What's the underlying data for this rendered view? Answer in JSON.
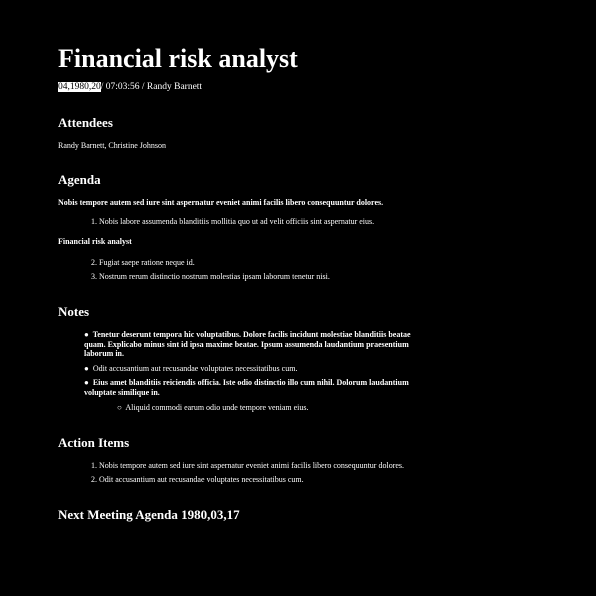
{
  "title": "Financial risk analyst",
  "meta": {
    "date": "04,1980,20",
    "rest": "/ 07:03:56 / Randy Barnett"
  },
  "attendees": {
    "heading": "Attendees",
    "names": "Randy Barnett, Christine Johnson"
  },
  "agenda": {
    "heading": "Agenda",
    "intro": "Nobis tempore autem sed iure sint aspernatur eveniet animi facilis libero consequuntur dolores.",
    "items_a": [
      "1. Nobis labore assumenda blanditiis mollitia quo ut ad velit officiis sint aspernatur eius."
    ],
    "subheading": "Financial risk analyst",
    "items_b": [
      "2. Fugiat saepe ratione neque id.",
      "3. Nostrum rerum distinctio nostrum molestias ipsam laborum tenetur nisi."
    ]
  },
  "notes": {
    "heading": "Notes",
    "bullet": "●",
    "sub_bullet": "○",
    "items": [
      "Tenetur deserunt tempora hic voluptatibus. Dolore facilis incidunt molestiae blanditiis beatae quam. Explicabo minus sint id ipsa maxime beatae. Ipsum assumenda laudantium praesentium laborum in.",
      "Odit accusantium aut recusandae voluptates necessitatibus cum.",
      "Eius amet blanditiis reiciendis officia. Iste odio distinctio illo cum nihil. Dolorum laudantium voluptate similique in."
    ],
    "sub_item": "Aliquid commodi earum odio unde tempore veniam eius."
  },
  "action_items": {
    "heading": "Action Items",
    "items": [
      "1. Nobis tempore autem sed iure sint aspernatur eveniet animi facilis libero consequuntur dolores.",
      "2. Odit accusantium aut recusandae voluptates necessitatibus cum."
    ]
  },
  "next_meeting": {
    "heading": "Next Meeting Agenda 1980,03,17"
  }
}
